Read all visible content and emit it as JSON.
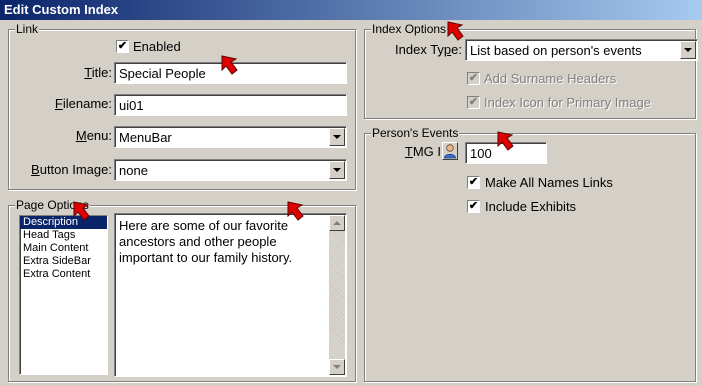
{
  "window": {
    "title": "Edit Custom Index"
  },
  "link": {
    "legend": "Link",
    "enabled_label": "Enabled",
    "enabled_checked": true,
    "title_label": "Title:",
    "title_value": "Special People",
    "filename_label": "Filename:",
    "filename_value": "ui01",
    "menu_label": "Menu:",
    "menu_value": "MenuBar",
    "button_image_label": "Button Image:",
    "button_image_value": "none"
  },
  "page_options": {
    "legend": "Page Options",
    "items": [
      "Description",
      "Head Tags",
      "Main Content",
      "Extra SideBar",
      "Extra Content"
    ],
    "selected_index": 0,
    "content_text": "Here are some of our favorite ancestors and other people important to our family history."
  },
  "index_options": {
    "legend": "Index Options",
    "index_type_label": "Index Type:",
    "index_type_value": "List based on person's events",
    "add_surname_headers_label": "Add Surname Headers",
    "index_icon_label": "Index Icon for Primary Image"
  },
  "persons_events": {
    "legend": "Person's Events",
    "tmg_id_label": "TMG ID:",
    "tmg_id_value": "100",
    "make_all_names_links_label": "Make All Names Links",
    "include_exhibits_label": "Include Exhibits"
  },
  "colors": {
    "annotation_arrow": "#e00000",
    "selection": "#0a246a",
    "face": "#d4d0c8"
  },
  "icons": {
    "checkmark": "check-icon",
    "dropdown": "chevron-down-icon",
    "person": "person-icon",
    "annotation": "red-arrow-icon"
  }
}
